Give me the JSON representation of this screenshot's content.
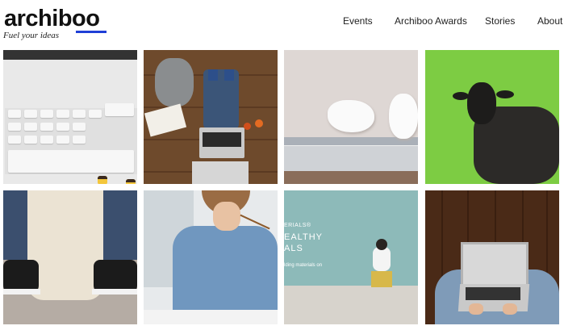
{
  "brand": {
    "name": "archiboo",
    "tagline": "Fuel your ideas",
    "accent_color": "#1f3fd6"
  },
  "nav": {
    "items": [
      {
        "label": "Events"
      },
      {
        "label": "Archiboo Awards"
      },
      {
        "label": "Stories"
      },
      {
        "label": "About"
      }
    ]
  },
  "gallery": {
    "tiles": [
      {
        "subject": "keyboard with lego figures"
      },
      {
        "subject": "laptop on wooden floor with cat"
      },
      {
        "subject": "white earbuds on phone"
      },
      {
        "subject": "black sheep on grass"
      },
      {
        "subject": "dog legs and sneakers"
      },
      {
        "subject": "woman holding pen"
      },
      {
        "subject": "child on stool by teal wall"
      },
      {
        "subject": "laptop on lap over wood floor"
      }
    ],
    "tile7_text": {
      "line1": "ERIALS®",
      "line2": "EALTHY",
      "line3": "ALS",
      "line4": "lding materials on"
    }
  }
}
